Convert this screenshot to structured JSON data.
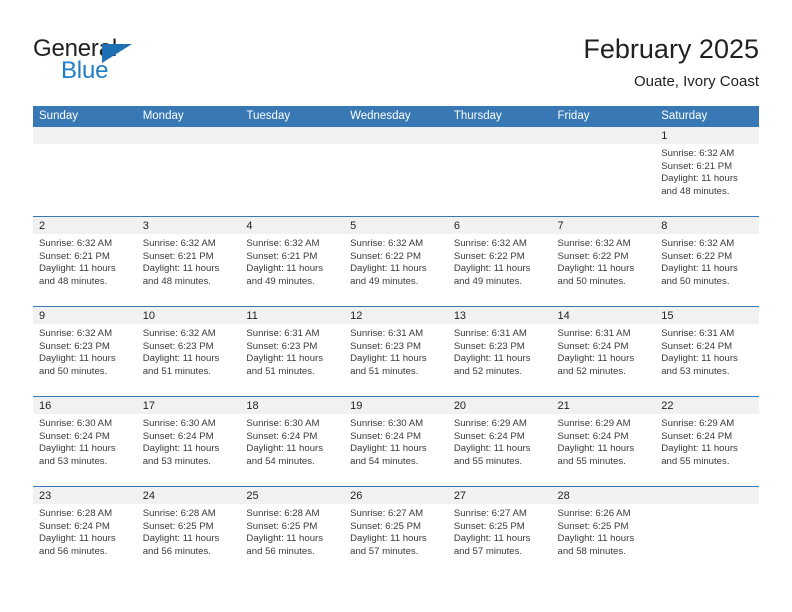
{
  "brand": {
    "name_top": "General",
    "name_bottom": "Blue",
    "triangle_color": "#1f6fb4",
    "blue_color": "#1f7ec4"
  },
  "header": {
    "title": "February 2025",
    "location": "Ouate, Ivory Coast"
  },
  "theme": {
    "header_bg": "#3878b4",
    "daynum_bg": "#f1f1f1",
    "rule_color": "#3878b4",
    "text_color": "#231f20"
  },
  "weekdays": [
    "Sunday",
    "Monday",
    "Tuesday",
    "Wednesday",
    "Thursday",
    "Friday",
    "Saturday"
  ],
  "labels": {
    "sunrise_prefix": "Sunrise:",
    "sunset_prefix": "Sunset:",
    "daylight_prefix": "Daylight:"
  },
  "weeks": [
    [
      {
        "empty": true
      },
      {
        "empty": true
      },
      {
        "empty": true
      },
      {
        "empty": true
      },
      {
        "empty": true
      },
      {
        "empty": true
      },
      {
        "day": "1",
        "sunrise": "Sunrise: 6:32 AM",
        "sunset": "Sunset: 6:21 PM",
        "daylight_1": "Daylight: 11 hours",
        "daylight_2": "and 48 minutes."
      }
    ],
    [
      {
        "day": "2",
        "sunrise": "Sunrise: 6:32 AM",
        "sunset": "Sunset: 6:21 PM",
        "daylight_1": "Daylight: 11 hours",
        "daylight_2": "and 48 minutes."
      },
      {
        "day": "3",
        "sunrise": "Sunrise: 6:32 AM",
        "sunset": "Sunset: 6:21 PM",
        "daylight_1": "Daylight: 11 hours",
        "daylight_2": "and 48 minutes."
      },
      {
        "day": "4",
        "sunrise": "Sunrise: 6:32 AM",
        "sunset": "Sunset: 6:21 PM",
        "daylight_1": "Daylight: 11 hours",
        "daylight_2": "and 49 minutes."
      },
      {
        "day": "5",
        "sunrise": "Sunrise: 6:32 AM",
        "sunset": "Sunset: 6:22 PM",
        "daylight_1": "Daylight: 11 hours",
        "daylight_2": "and 49 minutes."
      },
      {
        "day": "6",
        "sunrise": "Sunrise: 6:32 AM",
        "sunset": "Sunset: 6:22 PM",
        "daylight_1": "Daylight: 11 hours",
        "daylight_2": "and 49 minutes."
      },
      {
        "day": "7",
        "sunrise": "Sunrise: 6:32 AM",
        "sunset": "Sunset: 6:22 PM",
        "daylight_1": "Daylight: 11 hours",
        "daylight_2": "and 50 minutes."
      },
      {
        "day": "8",
        "sunrise": "Sunrise: 6:32 AM",
        "sunset": "Sunset: 6:22 PM",
        "daylight_1": "Daylight: 11 hours",
        "daylight_2": "and 50 minutes."
      }
    ],
    [
      {
        "day": "9",
        "sunrise": "Sunrise: 6:32 AM",
        "sunset": "Sunset: 6:23 PM",
        "daylight_1": "Daylight: 11 hours",
        "daylight_2": "and 50 minutes."
      },
      {
        "day": "10",
        "sunrise": "Sunrise: 6:32 AM",
        "sunset": "Sunset: 6:23 PM",
        "daylight_1": "Daylight: 11 hours",
        "daylight_2": "and 51 minutes."
      },
      {
        "day": "11",
        "sunrise": "Sunrise: 6:31 AM",
        "sunset": "Sunset: 6:23 PM",
        "daylight_1": "Daylight: 11 hours",
        "daylight_2": "and 51 minutes."
      },
      {
        "day": "12",
        "sunrise": "Sunrise: 6:31 AM",
        "sunset": "Sunset: 6:23 PM",
        "daylight_1": "Daylight: 11 hours",
        "daylight_2": "and 51 minutes."
      },
      {
        "day": "13",
        "sunrise": "Sunrise: 6:31 AM",
        "sunset": "Sunset: 6:23 PM",
        "daylight_1": "Daylight: 11 hours",
        "daylight_2": "and 52 minutes."
      },
      {
        "day": "14",
        "sunrise": "Sunrise: 6:31 AM",
        "sunset": "Sunset: 6:24 PM",
        "daylight_1": "Daylight: 11 hours",
        "daylight_2": "and 52 minutes."
      },
      {
        "day": "15",
        "sunrise": "Sunrise: 6:31 AM",
        "sunset": "Sunset: 6:24 PM",
        "daylight_1": "Daylight: 11 hours",
        "daylight_2": "and 53 minutes."
      }
    ],
    [
      {
        "day": "16",
        "sunrise": "Sunrise: 6:30 AM",
        "sunset": "Sunset: 6:24 PM",
        "daylight_1": "Daylight: 11 hours",
        "daylight_2": "and 53 minutes."
      },
      {
        "day": "17",
        "sunrise": "Sunrise: 6:30 AM",
        "sunset": "Sunset: 6:24 PM",
        "daylight_1": "Daylight: 11 hours",
        "daylight_2": "and 53 minutes."
      },
      {
        "day": "18",
        "sunrise": "Sunrise: 6:30 AM",
        "sunset": "Sunset: 6:24 PM",
        "daylight_1": "Daylight: 11 hours",
        "daylight_2": "and 54 minutes."
      },
      {
        "day": "19",
        "sunrise": "Sunrise: 6:30 AM",
        "sunset": "Sunset: 6:24 PM",
        "daylight_1": "Daylight: 11 hours",
        "daylight_2": "and 54 minutes."
      },
      {
        "day": "20",
        "sunrise": "Sunrise: 6:29 AM",
        "sunset": "Sunset: 6:24 PM",
        "daylight_1": "Daylight: 11 hours",
        "daylight_2": "and 55 minutes."
      },
      {
        "day": "21",
        "sunrise": "Sunrise: 6:29 AM",
        "sunset": "Sunset: 6:24 PM",
        "daylight_1": "Daylight: 11 hours",
        "daylight_2": "and 55 minutes."
      },
      {
        "day": "22",
        "sunrise": "Sunrise: 6:29 AM",
        "sunset": "Sunset: 6:24 PM",
        "daylight_1": "Daylight: 11 hours",
        "daylight_2": "and 55 minutes."
      }
    ],
    [
      {
        "day": "23",
        "sunrise": "Sunrise: 6:28 AM",
        "sunset": "Sunset: 6:24 PM",
        "daylight_1": "Daylight: 11 hours",
        "daylight_2": "and 56 minutes."
      },
      {
        "day": "24",
        "sunrise": "Sunrise: 6:28 AM",
        "sunset": "Sunset: 6:25 PM",
        "daylight_1": "Daylight: 11 hours",
        "daylight_2": "and 56 minutes."
      },
      {
        "day": "25",
        "sunrise": "Sunrise: 6:28 AM",
        "sunset": "Sunset: 6:25 PM",
        "daylight_1": "Daylight: 11 hours",
        "daylight_2": "and 56 minutes."
      },
      {
        "day": "26",
        "sunrise": "Sunrise: 6:27 AM",
        "sunset": "Sunset: 6:25 PM",
        "daylight_1": "Daylight: 11 hours",
        "daylight_2": "and 57 minutes."
      },
      {
        "day": "27",
        "sunrise": "Sunrise: 6:27 AM",
        "sunset": "Sunset: 6:25 PM",
        "daylight_1": "Daylight: 11 hours",
        "daylight_2": "and 57 minutes."
      },
      {
        "day": "28",
        "sunrise": "Sunrise: 6:26 AM",
        "sunset": "Sunset: 6:25 PM",
        "daylight_1": "Daylight: 11 hours",
        "daylight_2": "and 58 minutes."
      },
      {
        "empty": true
      }
    ]
  ]
}
